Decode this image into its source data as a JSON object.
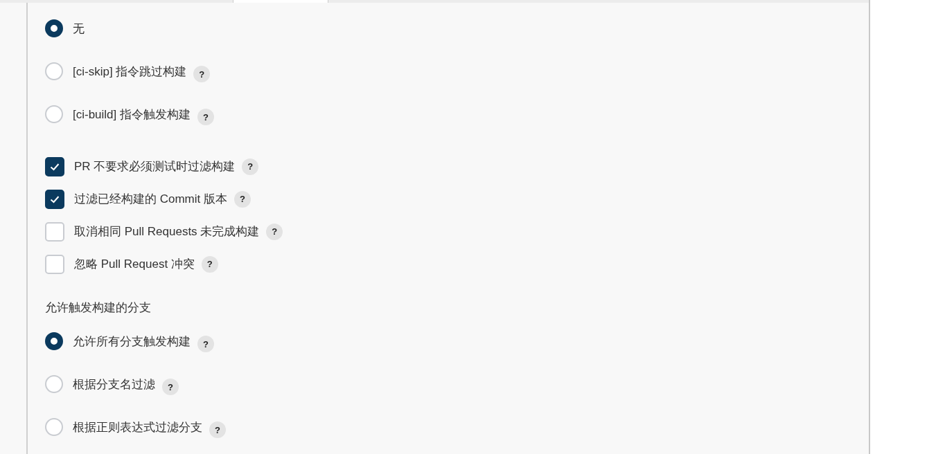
{
  "trigger_options": [
    {
      "label": "无",
      "selected": true
    },
    {
      "label": "[ci-skip] 指令跳过构建",
      "selected": false,
      "help": "?"
    },
    {
      "label": "[ci-build] 指令触发构建",
      "selected": false,
      "help": "?"
    }
  ],
  "filters": [
    {
      "label": "PR 不要求必须测试时过滤构建",
      "checked": true,
      "help": "?"
    },
    {
      "label": "过滤已经构建的 Commit 版本",
      "checked": true,
      "help": "?"
    },
    {
      "label": "取消相同 Pull Requests 未完成构建",
      "checked": false,
      "help": "?"
    },
    {
      "label": "忽略 Pull Request 冲突",
      "checked": false,
      "help": "?"
    }
  ],
  "branch_section": {
    "label": "允许触发构建的分支",
    "options": [
      {
        "label": "允许所有分支触发构建",
        "selected": true,
        "help": "?"
      },
      {
        "label": "根据分支名过滤",
        "selected": false,
        "help": "?"
      },
      {
        "label": "根据正则表达式过滤分支",
        "selected": false,
        "help": "?"
      }
    ]
  }
}
